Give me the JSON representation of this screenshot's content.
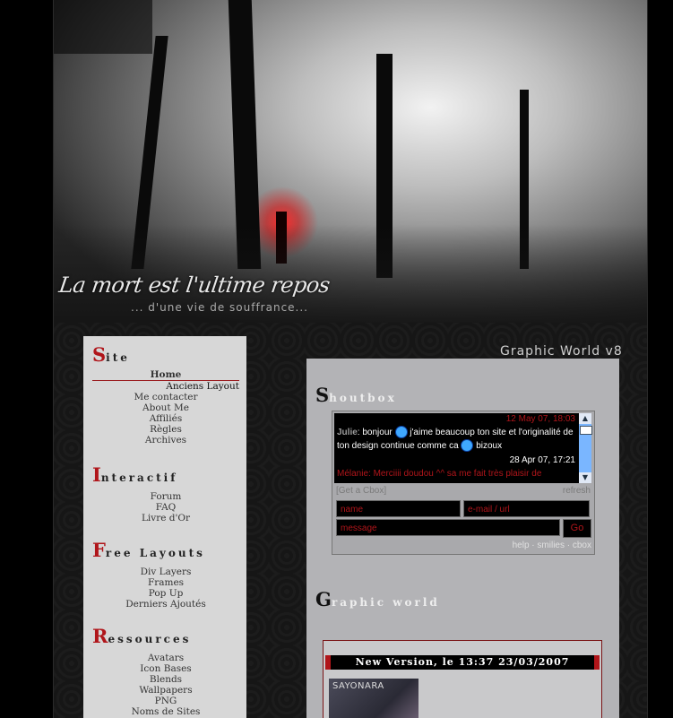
{
  "banner": {
    "title": "La mort est l'ultime repos",
    "subtitle": "... d'une vie de souffrance...",
    "site_version": "Graphic World  v8"
  },
  "sidebar": {
    "sections": [
      {
        "cap": "S",
        "rest": "ite",
        "items": [
          {
            "label": "Home",
            "state": "active"
          },
          {
            "label": "Anciens Layout",
            "state": "sub"
          },
          {
            "label": "Me contacter"
          },
          {
            "label": "About Me"
          },
          {
            "label": "Affiliés"
          },
          {
            "label": "Règles"
          },
          {
            "label": "Archives"
          }
        ]
      },
      {
        "cap": "I",
        "rest": "nteractif",
        "items": [
          {
            "label": "Forum"
          },
          {
            "label": "FAQ"
          },
          {
            "label": "Livre d'Or"
          }
        ]
      },
      {
        "cap": "F",
        "rest": "ree Layouts",
        "items": [
          {
            "label": "Div Layers"
          },
          {
            "label": "Frames"
          },
          {
            "label": "Pop Up"
          },
          {
            "label": "Derniers Ajoutés"
          }
        ]
      },
      {
        "cap": "R",
        "rest": "essources",
        "items": [
          {
            "label": "Avatars"
          },
          {
            "label": "Icon Bases"
          },
          {
            "label": "Blends"
          },
          {
            "label": "Wallpapers"
          },
          {
            "label": "PNG"
          },
          {
            "label": "Noms de Sites"
          }
        ]
      }
    ]
  },
  "shoutbox": {
    "cap": "S",
    "rest": "houtbox",
    "messages": [
      {
        "date": "12 May 07, 18:03",
        "name": "Julie",
        "text1": ": bonjour ",
        "text2": " j'aime beaucoup ton site et l'originalité de ton design continue comme ca ",
        "text3": " bizoux"
      },
      {
        "date": "28 Apr 07, 17:21",
        "name": "Mélanie",
        "text1": ": Merciiii doudou ^^ sa me fait très plaisir de"
      }
    ],
    "get_cbox": "[Get a Cbox]",
    "refresh": "refresh",
    "name_placeholder": "name",
    "email_placeholder": "e-mail / url",
    "message_placeholder": "message",
    "go_label": "Go",
    "footer_links": [
      "help",
      "smilies",
      "cbox"
    ]
  },
  "graphic_world": {
    "cap": "G",
    "rest": "raphic world",
    "news_title": "New Version, le 13:37 23/03/2007",
    "thumb_label": "SAYONARA"
  },
  "colors": {
    "accent": "#b0151a",
    "sidebar_bg": "#d7d7d7",
    "main_bg": "#b3b3b6"
  }
}
